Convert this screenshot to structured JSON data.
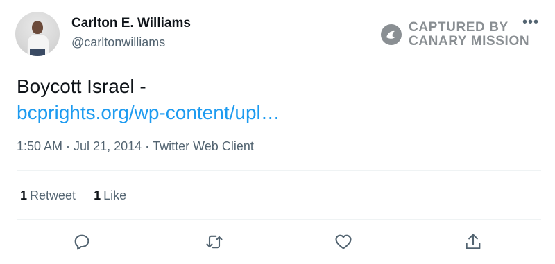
{
  "user": {
    "name": "Carlton E. Williams",
    "handle": "@carltonwilliams"
  },
  "watermark": {
    "line1": "CAPTURED BY",
    "line2": "CANARY MISSION"
  },
  "more_icon": "more-horizontal-icon",
  "tweet": {
    "text": "Boycott Israel -",
    "link": "bcprights.org/wp-content/upl…",
    "time": "1:50 AM",
    "date": "Jul 21, 2014",
    "client": "Twitter Web Client",
    "separator": "·"
  },
  "stats": {
    "retweets": {
      "count": "1",
      "label": "Retweet"
    },
    "likes": {
      "count": "1",
      "label": "Like"
    }
  },
  "actions": [
    "reply-icon",
    "retweet-icon",
    "like-icon",
    "share-icon"
  ],
  "colors": {
    "link": "#1d9bf0",
    "secondary_text": "#536471",
    "primary_text": "#0f1419",
    "divider": "#eff3f4",
    "watermark": "#8a8f93"
  }
}
